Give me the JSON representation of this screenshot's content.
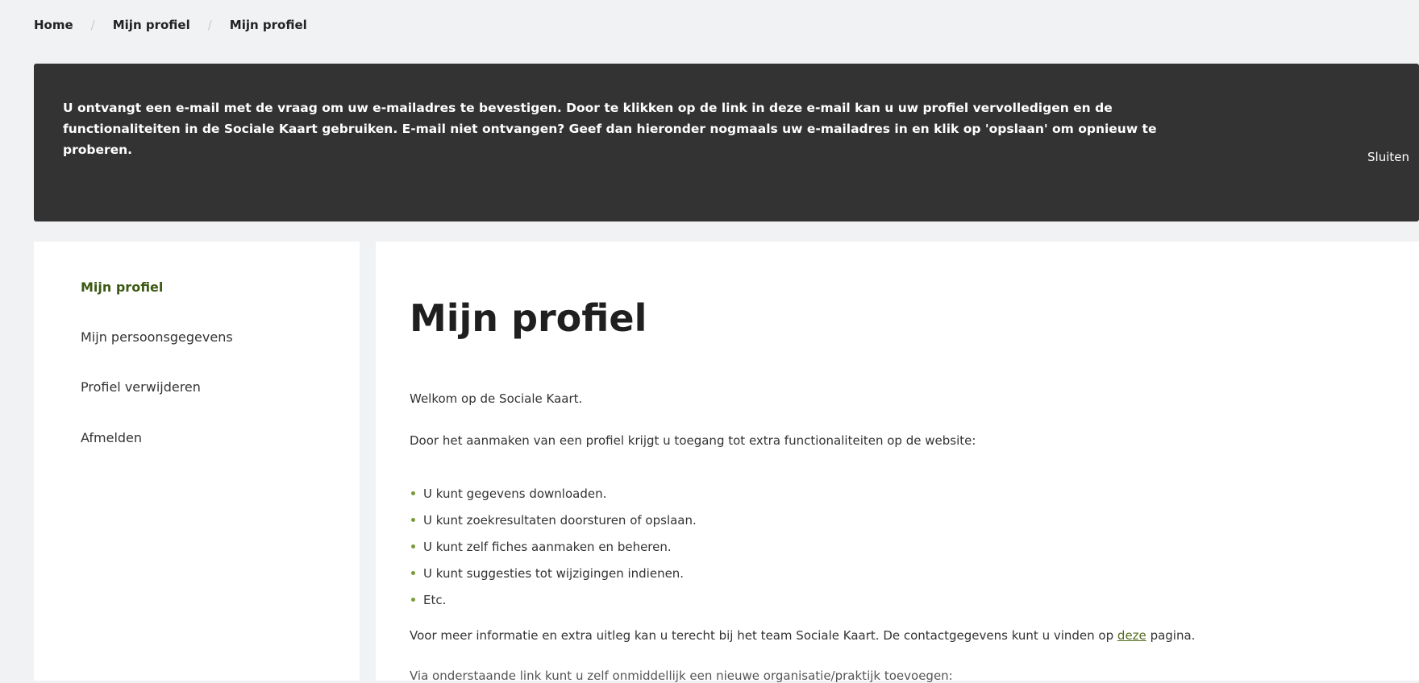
{
  "breadcrumb": {
    "items": [
      "Home",
      "Mijn profiel",
      "Mijn profiel"
    ]
  },
  "banner": {
    "line1": "U ontvangt een e-mail met de vraag om uw e-mailadres te bevestigen. Door te klikken op de link in deze e-mail kan u uw profiel vervolledigen en de",
    "line2": "functionaliteiten in de Sociale Kaart gebruiken. E-mail niet ontvangen? Geef dan hieronder nogmaals uw e-mailadres in en klik op 'opslaan' om opnieuw te",
    "line3": "proberen.",
    "close_label": "Sluiten"
  },
  "sidebar": {
    "items": [
      {
        "label": "Mijn profiel",
        "active": true
      },
      {
        "label": "Mijn persoonsgegevens"
      },
      {
        "label": "Profiel verwijderen"
      },
      {
        "label": "Afmelden"
      }
    ]
  },
  "main": {
    "title": "Mijn profiel",
    "welcome": "Welkom op de Sociale Kaart.",
    "intro": "Door het aanmaken van een profiel krijgt u toegang tot extra functionaliteiten op de website:",
    "features": [
      "U kunt gegevens downloaden.",
      "U kunt zoekresultaten doorsturen of opslaan.",
      "U kunt zelf fiches aanmaken en beheren.",
      "U kunt suggesties tot wijzigingen indienen.",
      "Etc."
    ],
    "info_text": "Voor meer informatie en extra uitleg kan u terecht bij het team Sociale Kaart. De contactgegevens kunt u vinden op",
    "info_link": "deze",
    "info_after": "pagina.",
    "cutoff_text": "Via onderstaande link kunt u zelf onmiddellijk een nieuwe organisatie/praktijk toevoegen:"
  },
  "colors": {
    "banner_bg": "#333333",
    "accent_green": "#3d5a14",
    "page_bg": "#f0f2f4"
  }
}
